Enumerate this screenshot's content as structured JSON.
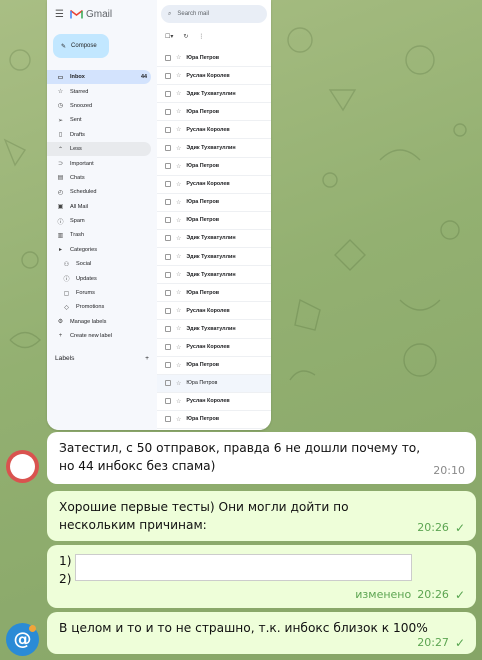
{
  "gmail": {
    "app_name": "Gmail",
    "compose_label": "Compose",
    "search_placeholder": "Search mail",
    "nav": [
      {
        "label": "Inbox",
        "icon": "inbox-icon",
        "count": "44"
      },
      {
        "label": "Starred",
        "icon": "star-icon"
      },
      {
        "label": "Snoozed",
        "icon": "clock-icon"
      },
      {
        "label": "Sent",
        "icon": "send-icon"
      },
      {
        "label": "Drafts",
        "icon": "draft-icon"
      },
      {
        "label": "Less",
        "icon": "chevron-up-icon"
      },
      {
        "label": "Important",
        "icon": "important-icon"
      },
      {
        "label": "Chats",
        "icon": "chat-icon"
      },
      {
        "label": "Scheduled",
        "icon": "scheduled-icon"
      },
      {
        "label": "All Mail",
        "icon": "all-mail-icon"
      },
      {
        "label": "Spam",
        "icon": "spam-icon"
      },
      {
        "label": "Trash",
        "icon": "trash-icon"
      },
      {
        "label": "Categories",
        "icon": "label-icon"
      },
      {
        "label": "Social",
        "icon": "social-icon"
      },
      {
        "label": "Updates",
        "icon": "info-icon"
      },
      {
        "label": "Forums",
        "icon": "forum-icon"
      },
      {
        "label": "Promotions",
        "icon": "tag-icon"
      },
      {
        "label": "Manage labels",
        "icon": "gear-icon"
      },
      {
        "label": "Create new label",
        "icon": "plus-icon"
      }
    ],
    "labels_header": "Labels",
    "rows": [
      {
        "sender": "Юра Петров",
        "read": false
      },
      {
        "sender": "Руслан Королев",
        "read": false
      },
      {
        "sender": "Эдик Тухватуллин",
        "read": false
      },
      {
        "sender": "Юра Петров",
        "read": false
      },
      {
        "sender": "Руслан Королев",
        "read": false
      },
      {
        "sender": "Эдик Тухватуллин",
        "read": false
      },
      {
        "sender": "Юра Петров",
        "read": false
      },
      {
        "sender": "Руслан Королев",
        "read": false
      },
      {
        "sender": "Юра Петров",
        "read": false
      },
      {
        "sender": "Юра Петров",
        "read": false
      },
      {
        "sender": "Эдик Тухватуллин",
        "read": false
      },
      {
        "sender": "Эдик Тухватуллин",
        "read": false
      },
      {
        "sender": "Эдик Тухватуллин",
        "read": false
      },
      {
        "sender": "Юра Петров",
        "read": false
      },
      {
        "sender": "Руслан Королев",
        "read": false
      },
      {
        "sender": "Эдик Тухватуллин",
        "read": false
      },
      {
        "sender": "Руслан Королев",
        "read": false
      },
      {
        "sender": "Юра Петров",
        "read": false
      },
      {
        "sender": "Юра Петров",
        "read": true
      },
      {
        "sender": "Руслан Королев",
        "read": false
      },
      {
        "sender": "Юра Петров",
        "read": false
      }
    ]
  },
  "messages": [
    {
      "text": "Затестил, с 50 отправок, правда 6 не дошли почему то, но 44 инбокс без спама)",
      "time": "20:10"
    },
    {
      "text": "Хорошие первые тесты) Они могли дойти по нескольким причинам:",
      "time": "20:26"
    },
    {
      "line1": "1)",
      "line2": "2)",
      "time": "20:26",
      "edited": "изменено"
    },
    {
      "text": "В целом и то и то не страшно, т.к. инбокс близок к 100%",
      "time": "20:27"
    }
  ],
  "colors": {
    "outgoing_bubble": "#eefed9",
    "incoming_bubble": "#ffffff",
    "check": "#56a44f",
    "gmail_active": "#d3e3fd"
  }
}
